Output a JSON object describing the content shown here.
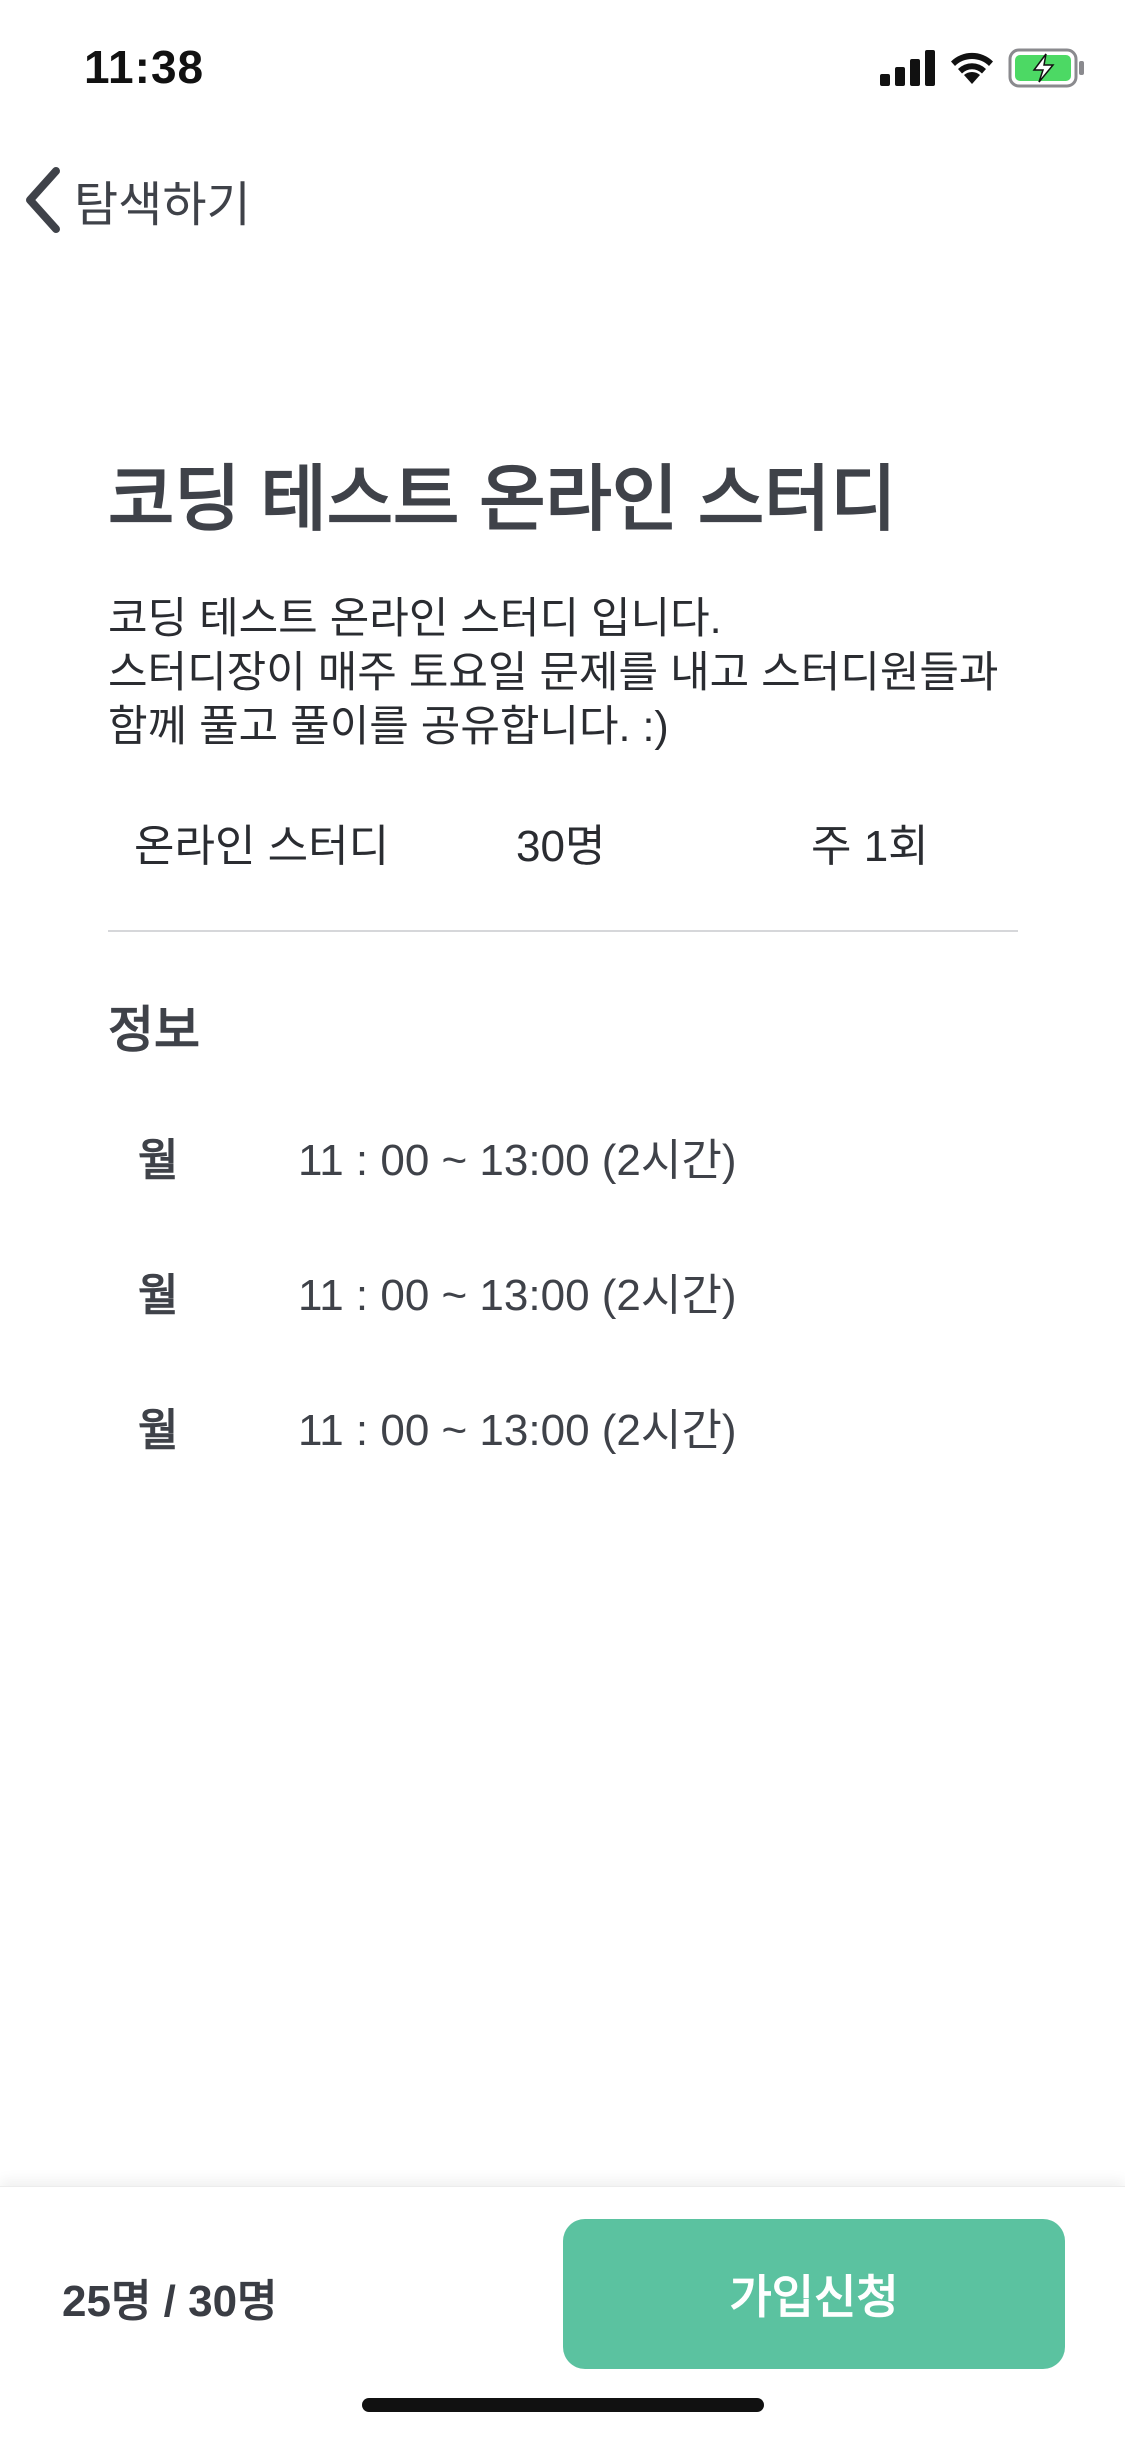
{
  "status_bar": {
    "time": "11:38"
  },
  "nav": {
    "back_label": "탐색하기"
  },
  "study": {
    "title": "코딩 테스트 온라인 스터디",
    "description_lines": [
      "코딩 테스트 온라인 스터디 입니다.",
      "스터디장이 매주 토요일 문제를 내고 스터디원들과",
      "함께 풀고 풀이를 공유합니다. :)"
    ],
    "meta": {
      "type": "온라인 스터디",
      "capacity": "30명",
      "frequency": "주 1회"
    }
  },
  "info": {
    "section_title": "정보",
    "schedule": [
      {
        "day": "월",
        "time": "11 : 00 ~ 13:00 (2시간)"
      },
      {
        "day": "월",
        "time": "11 : 00 ~ 13:00 (2시간)"
      },
      {
        "day": "월",
        "time": "11 : 00 ~ 13:00 (2시간)"
      }
    ]
  },
  "bottom_bar": {
    "member_count": "25명 / 30명",
    "join_label": "가입신청"
  },
  "colors": {
    "accent": "#5bc2a0",
    "text_primary": "#3f4249",
    "divider": "#d6d7da",
    "battery_green": "#4cd964"
  }
}
